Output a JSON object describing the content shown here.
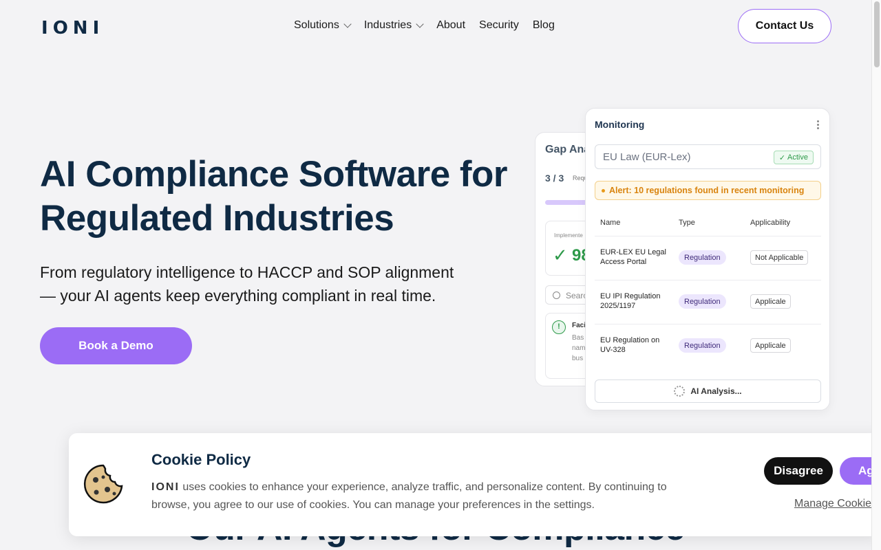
{
  "header": {
    "logo": [
      "I",
      "O",
      "N",
      "I"
    ],
    "nav": [
      {
        "label": "Solutions",
        "dropdown": true
      },
      {
        "label": "Industries",
        "dropdown": true
      },
      {
        "label": "About",
        "dropdown": false
      },
      {
        "label": "Security",
        "dropdown": false
      },
      {
        "label": "Blog",
        "dropdown": false
      }
    ],
    "contact_label": "Contact Us"
  },
  "hero": {
    "title_line1": "AI Compliance Software for",
    "title_line2": "Regulated Industries",
    "subtitle_line1": "From regulatory intelligence to HACCP and SOP alignment",
    "subtitle_line2": "— your AI agents keep everything compliant in real time.",
    "demo_label": "Book a Demo"
  },
  "gap_card": {
    "title": "Gap Ana",
    "count": "3 / 3",
    "req_label": "Requ",
    "impl_label": "Implemente",
    "impl_value": "98",
    "search_placeholder": "Searc",
    "facility_title": "Faci",
    "facility_lines": [
      "Bas",
      "nam",
      "bus"
    ]
  },
  "monitoring": {
    "title": "Monitoring",
    "source": "EU Law (EUR-Lex)",
    "status": "Active",
    "alert": "Alert: 10 regulations found in recent monitoring",
    "columns": [
      "Name",
      "Type",
      "Applicability"
    ],
    "rows": [
      {
        "name": "EUR-LEX EU Legal Access Portal",
        "type": "Regulation",
        "applicability": "Not Applicable"
      },
      {
        "name": "EU IPI Regulation 2025/1197",
        "type": "Regulation",
        "applicability": "Applicale"
      },
      {
        "name": "EU Regulation on UV-328",
        "type": "Regulation",
        "applicability": "Applicale"
      }
    ],
    "ai_label": "AI Analysis..."
  },
  "section_heading": "Our AI Agents for Compliance",
  "cookie": {
    "title": "Cookie Policy",
    "brand": "IONI",
    "text": " uses cookies to enhance your experience, analyze traffic, and personalize content. By continuing to browse, you agree to our use of cookies. You can manage your preferences in the settings.",
    "disagree_label": "Disagree",
    "agree_label": "Agree",
    "manage_label": "Manage Cookies"
  },
  "colors": {
    "accent": "#9b6cf5",
    "navy": "#0f2a44",
    "success": "#2e9a4a",
    "warning": "#d9840f"
  }
}
